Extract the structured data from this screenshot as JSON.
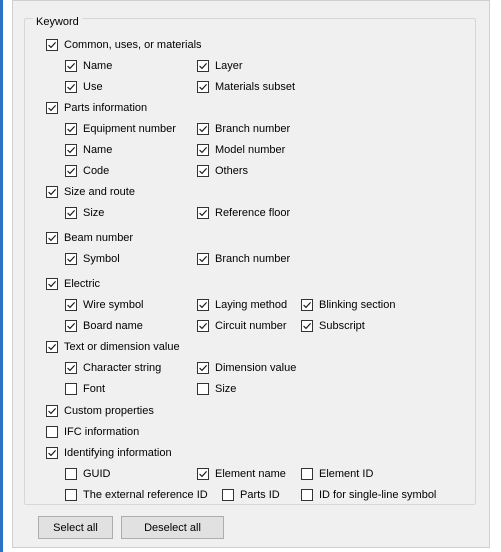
{
  "group_title": "Keyword",
  "checkboxes": [
    {
      "label": "Common, uses, or materials",
      "checked": true
    },
    {
      "label": "Name",
      "checked": true
    },
    {
      "label": "Layer",
      "checked": true
    },
    {
      "label": "Use",
      "checked": true
    },
    {
      "label": "Materials subset",
      "checked": true
    },
    {
      "label": "Parts information",
      "checked": true
    },
    {
      "label": "Equipment number",
      "checked": true
    },
    {
      "label": "Branch number",
      "checked": true
    },
    {
      "label": "Name",
      "checked": true
    },
    {
      "label": "Model number",
      "checked": true
    },
    {
      "label": "Code",
      "checked": true
    },
    {
      "label": "Others",
      "checked": true
    },
    {
      "label": "Size and route",
      "checked": true
    },
    {
      "label": "Size",
      "checked": true
    },
    {
      "label": "Reference floor",
      "checked": true
    },
    {
      "label": "Beam number",
      "checked": true
    },
    {
      "label": "Symbol",
      "checked": true
    },
    {
      "label": "Branch number",
      "checked": true
    },
    {
      "label": "Electric",
      "checked": true
    },
    {
      "label": "Wire symbol",
      "checked": true
    },
    {
      "label": "Laying method",
      "checked": true
    },
    {
      "label": "Blinking section",
      "checked": true
    },
    {
      "label": "Board name",
      "checked": true
    },
    {
      "label": "Circuit number",
      "checked": true
    },
    {
      "label": "Subscript",
      "checked": true
    },
    {
      "label": "Text or dimension value",
      "checked": true
    },
    {
      "label": "Character string",
      "checked": true
    },
    {
      "label": "Dimension value",
      "checked": true
    },
    {
      "label": "Font",
      "checked": false
    },
    {
      "label": "Size",
      "checked": false
    },
    {
      "label": "Custom properties",
      "checked": true
    },
    {
      "label": "IFC information",
      "checked": false
    },
    {
      "label": "Identifying information",
      "checked": true
    },
    {
      "label": "GUID",
      "checked": false
    },
    {
      "label": "Element name",
      "checked": true
    },
    {
      "label": "Element ID",
      "checked": false
    },
    {
      "label": "The external reference ID",
      "checked": false
    },
    {
      "label": "Parts ID",
      "checked": false
    },
    {
      "label": "ID for single-line symbol",
      "checked": false
    }
  ],
  "buttons": {
    "select_all": "Select all",
    "deselect_all": "Deselect all"
  }
}
